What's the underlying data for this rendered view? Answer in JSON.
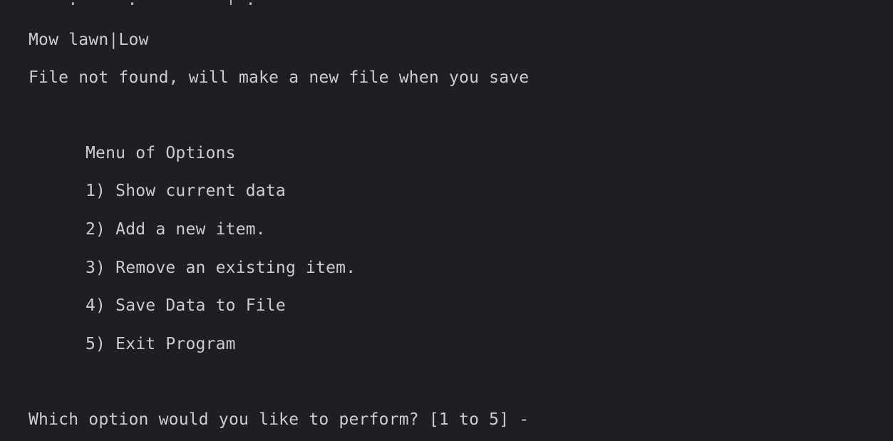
{
  "console": {
    "clipped_previous_line": "` ´ ,   ´ ,       ´ | ,             ´   ´       ´       ´",
    "lines": [
      "Mow lawn|Low",
      "File not found, will make a new file when you save"
    ],
    "menu": {
      "title": "Menu of Options",
      "options": [
        "1) Show current data",
        "2) Add a new item.",
        "3) Remove an existing item.",
        "4) Save Data to File",
        "5) Exit Program"
      ]
    },
    "prompt": "Which option would you like to perform? [1 to 5] -"
  }
}
